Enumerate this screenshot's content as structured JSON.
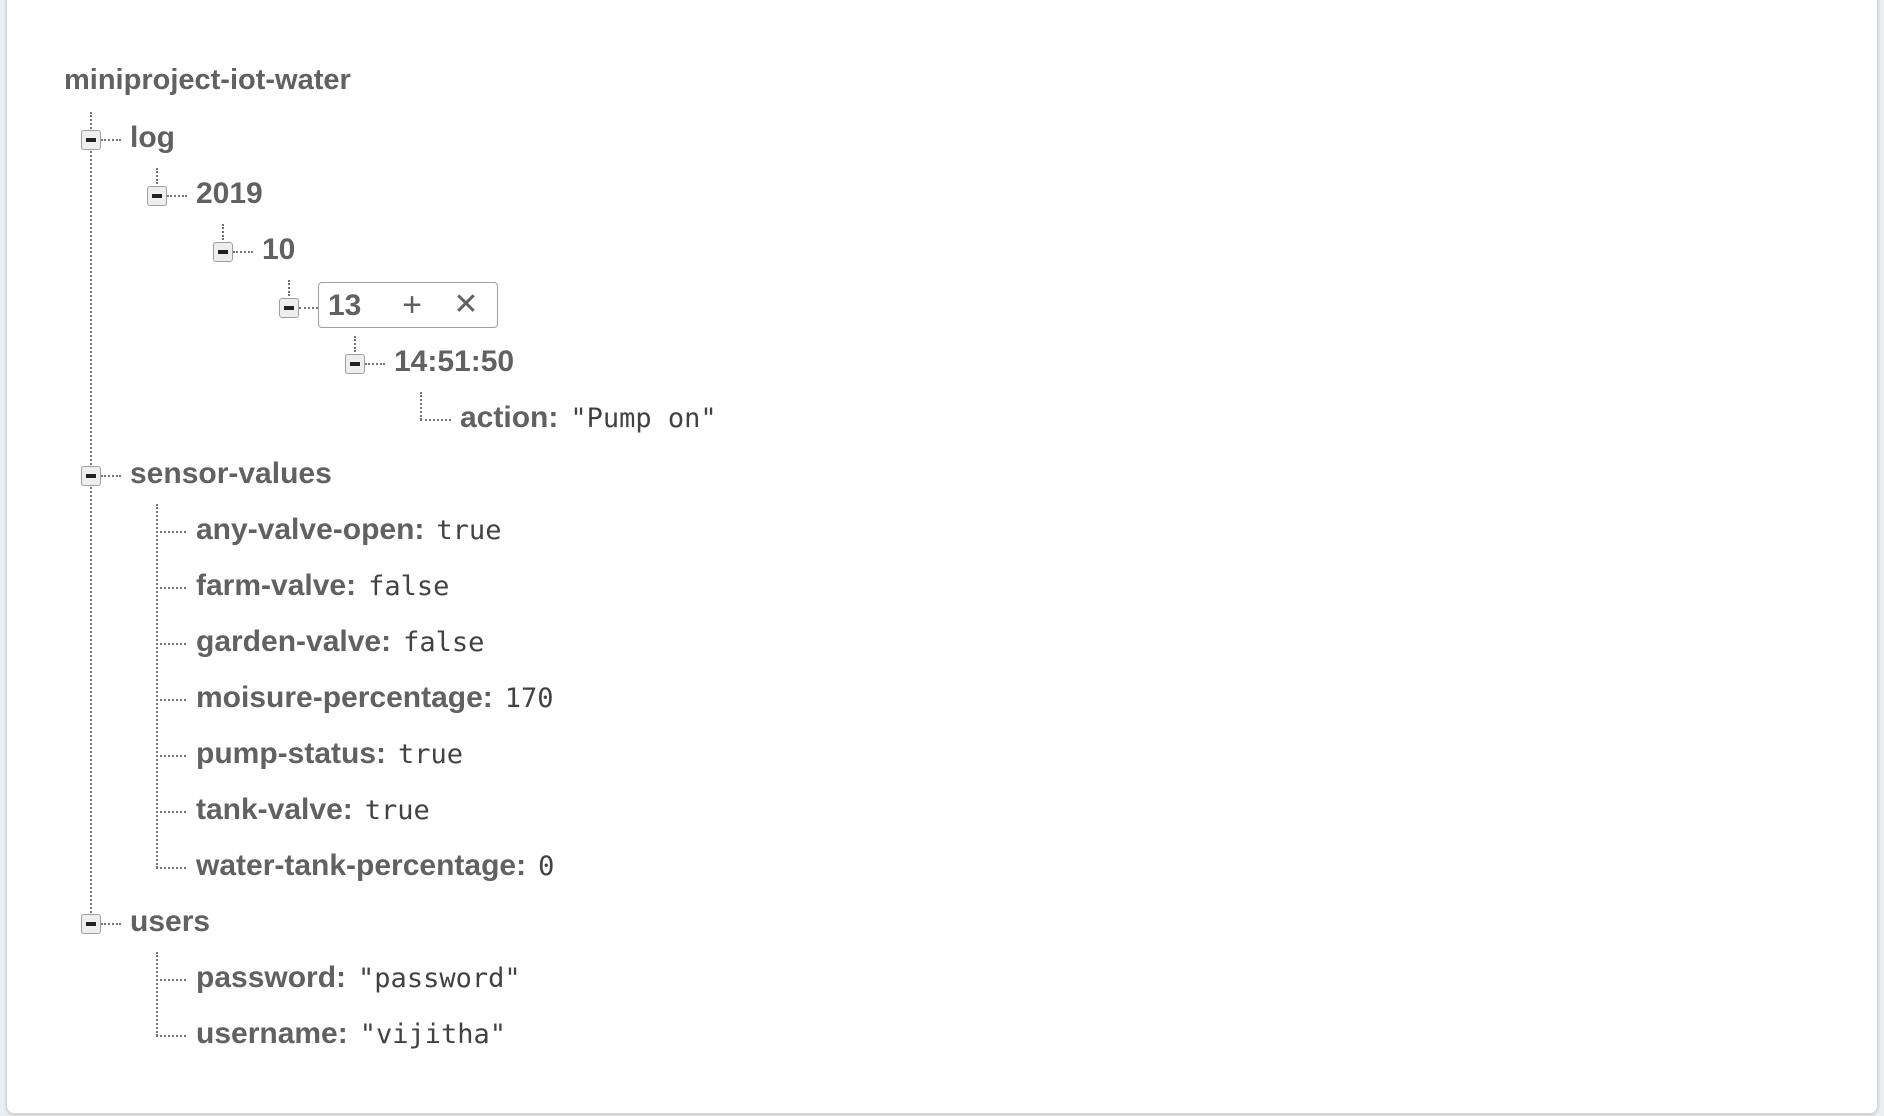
{
  "root": {
    "title": "miniproject-iot-water"
  },
  "nodes": {
    "log": {
      "key": "log"
    },
    "year": {
      "key": "2019"
    },
    "month": {
      "key": "10"
    },
    "day": {
      "key": "13",
      "add_icon": "plus-icon",
      "remove_icon": "close-icon",
      "add_glyph": "+",
      "remove_glyph": "✕"
    },
    "time": {
      "key": "14:51:50"
    },
    "action": {
      "key": "action",
      "value": "\"Pump on\""
    },
    "sensor_values": {
      "key": "sensor-values"
    },
    "users": {
      "key": "users"
    }
  },
  "sensor_values": [
    {
      "key": "any-valve-open",
      "value": "true"
    },
    {
      "key": "farm-valve",
      "value": "false"
    },
    {
      "key": "garden-valve",
      "value": "false"
    },
    {
      "key": "moisure-percentage",
      "value": "170"
    },
    {
      "key": "pump-status",
      "value": "true"
    },
    {
      "key": "tank-valve",
      "value": "true"
    },
    {
      "key": "water-tank-percentage",
      "value": "0"
    }
  ],
  "users": [
    {
      "key": "password",
      "value": "\"password\""
    },
    {
      "key": "username",
      "value": "\"vijitha\""
    }
  ],
  "separator": ":",
  "colors": {
    "text": "#616161",
    "value": "#424242",
    "connector": "#757575",
    "panel": "#ffffff"
  }
}
